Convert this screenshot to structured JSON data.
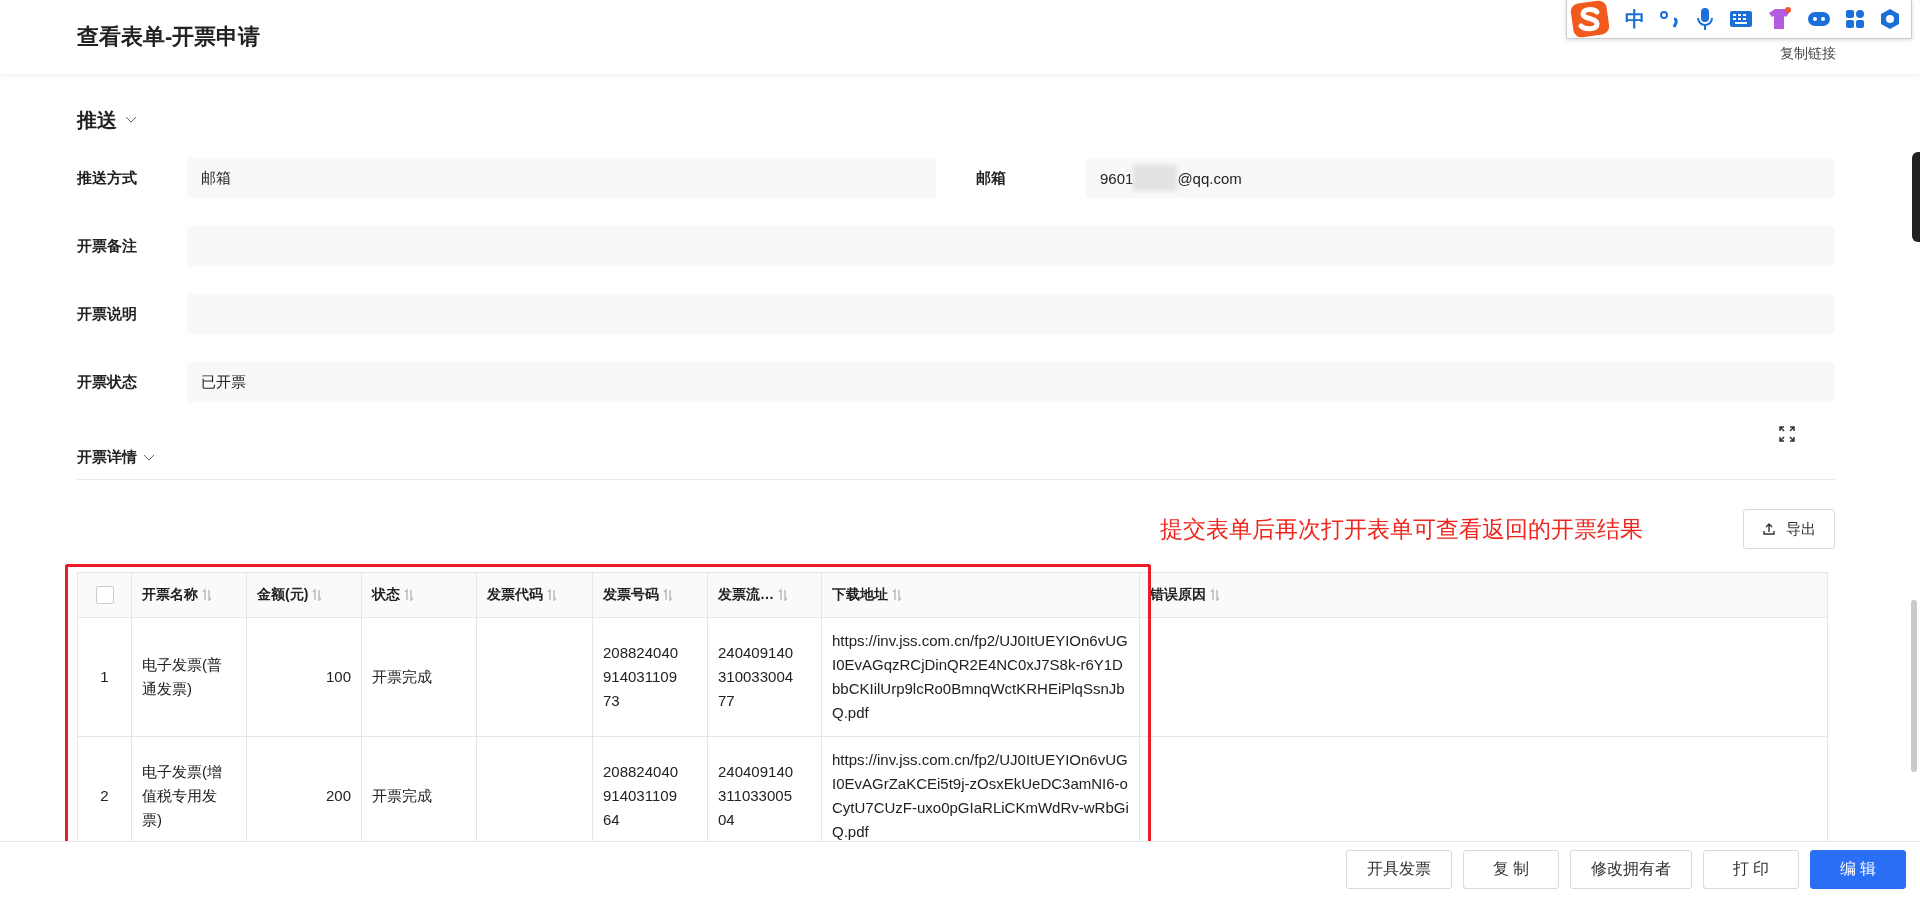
{
  "header": {
    "title": "查看表单-开票申请",
    "copy_link": "复制链接"
  },
  "ime_toolbar": {
    "mode": "中"
  },
  "section": {
    "title": "推送",
    "expanded": true
  },
  "fields": [
    {
      "label": "推送方式",
      "value": "邮箱",
      "kind": "half"
    },
    {
      "label": "邮箱",
      "value_start": "9601",
      "value_end": "@qq.com",
      "kind": "masked"
    },
    {
      "label": "开票备注",
      "kind": "full"
    },
    {
      "label": "开票说明",
      "kind": "full"
    },
    {
      "label": "开票状态",
      "value": "已开票",
      "kind": "full"
    }
  ],
  "details": {
    "title": "开票详情",
    "expanded": true,
    "annotation": "提交表单后再次打开表单可查看返回的开票结果",
    "export_button": "导出"
  },
  "table": {
    "select_all_checked": false,
    "columns": [
      {
        "label": "开票名称"
      },
      {
        "label": "金额(元)"
      },
      {
        "label": "状态"
      },
      {
        "label": "发票代码"
      },
      {
        "label": "发票号码"
      },
      {
        "label": "发票流…"
      },
      {
        "label": "下载地址"
      },
      {
        "label": "错误原因"
      }
    ],
    "rows": [
      {
        "index": "1",
        "cells": [
          "电子发票(普通发票)",
          "100",
          "开票完成",
          "",
          "208824040914031109 73",
          "240409140310033004 77",
          "https://inv.jss.com.cn/fp2/UJ0ItUEYIOn6vUGI0EvAGqzRCjDinQR2E4NC0xJ7S8k-r6Y1DbbCKIilUrp9lcRo0BmnqWctKRHEiPlqSsnJbQ.pdf",
          ""
        ]
      },
      {
        "index": "2",
        "cells": [
          "电子发票(增值税专用发票)",
          "200",
          "开票完成",
          "",
          "208824040914031109 64",
          "240409140311033005 04",
          "https://inv.jss.com.cn/fp2/UJ0ItUEYIOn6vUGI0EvAGrZaKCEi5t9j-zOsxEkUeDC3amNI6-oCytU7CUzF-uxo0pGIaRLiCKmWdRv-wRbGiQ.pdf",
          ""
        ]
      }
    ]
  },
  "footer_buttons": [
    {
      "label": "开具发票",
      "kind": "default"
    },
    {
      "label": "复 制",
      "kind": "default"
    },
    {
      "label": "修改拥有者",
      "kind": "default"
    },
    {
      "label": "打 印",
      "kind": "default"
    },
    {
      "label": "编 辑",
      "kind": "primary"
    }
  ]
}
